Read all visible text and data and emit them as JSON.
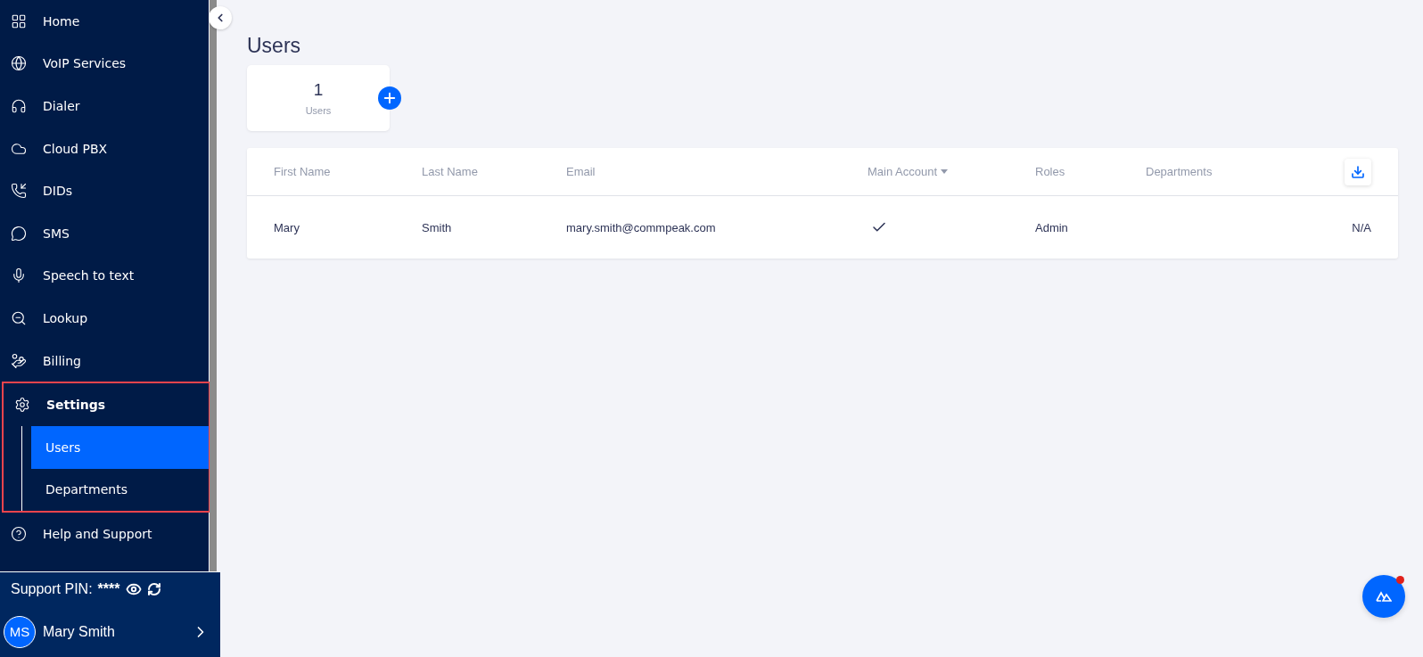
{
  "sidebar": {
    "items": [
      {
        "label": "Home",
        "selected": false
      },
      {
        "label": "VoIP Services",
        "selected": false
      },
      {
        "label": "Dialer",
        "selected": false
      },
      {
        "label": "Cloud PBX",
        "selected": false
      },
      {
        "label": "DIDs",
        "selected": false
      },
      {
        "label": "SMS",
        "selected": false
      },
      {
        "label": "Speech to text",
        "selected": false
      },
      {
        "label": "Lookup",
        "selected": false
      },
      {
        "label": "Billing",
        "selected": false
      },
      {
        "label": "Settings",
        "selected": false,
        "expanded": true,
        "highlighted": true,
        "children": [
          {
            "label": "Users",
            "selected": true
          },
          {
            "label": "Departments",
            "selected": false
          }
        ]
      },
      {
        "label": "Help and Support",
        "selected": false
      }
    ]
  },
  "support_pin": {
    "label": "Support PIN:",
    "value": "****"
  },
  "user": {
    "initials": "MS",
    "name": "Mary Smith"
  },
  "page": {
    "title": "Users"
  },
  "summary_card": {
    "count": "1",
    "label": "Users"
  },
  "table": {
    "columns": [
      {
        "label": "First Name",
        "sortable": false
      },
      {
        "label": "Last Name",
        "sortable": false
      },
      {
        "label": "Email",
        "sortable": false
      },
      {
        "label": "Main Account",
        "sortable": true
      },
      {
        "label": "Roles",
        "sortable": false
      },
      {
        "label": "Departments",
        "sortable": false
      }
    ],
    "rows": [
      {
        "first_name": "Mary",
        "last_name": "Smith",
        "email": "mary.smith@commpeak.com",
        "main_account": true,
        "roles": "Admin",
        "departments": "N/A"
      }
    ]
  },
  "chat_button": {
    "unread": true
  }
}
